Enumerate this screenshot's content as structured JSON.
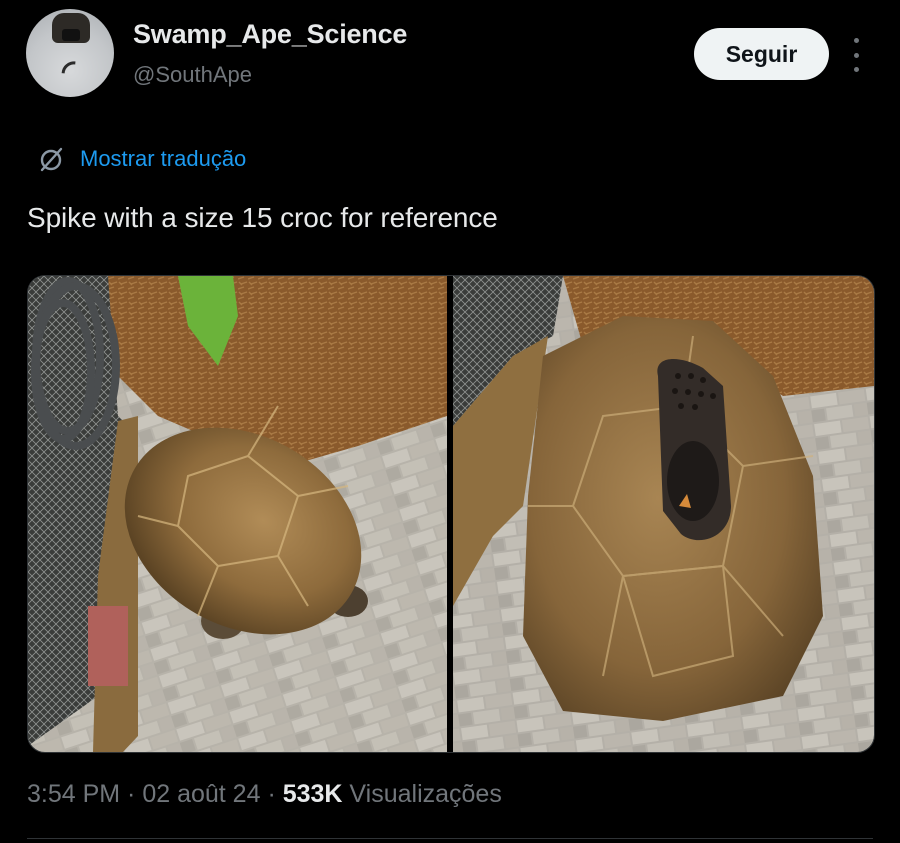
{
  "author": {
    "display_name": "Swamp_Ape_Science",
    "handle": "@SouthApe"
  },
  "actions": {
    "follow_label": "Seguir",
    "more_icon": "more-vertical-icon"
  },
  "translate": {
    "icon": "translate-icon",
    "label": "Mostrar tradução"
  },
  "tweet": {
    "text": "Spike with a size 15 croc for reference"
  },
  "media": {
    "count": 2
  },
  "meta": {
    "time": "3:54 PM",
    "sep1": " · ",
    "date": "02 août 24",
    "sep2": " · ",
    "views_count": "533K",
    "views_label": " Visualizações"
  },
  "colors": {
    "background": "#000000",
    "text": "#e7e9ea",
    "muted": "#71767b",
    "link": "#1d9bf0",
    "button_bg": "#eff3f4"
  }
}
